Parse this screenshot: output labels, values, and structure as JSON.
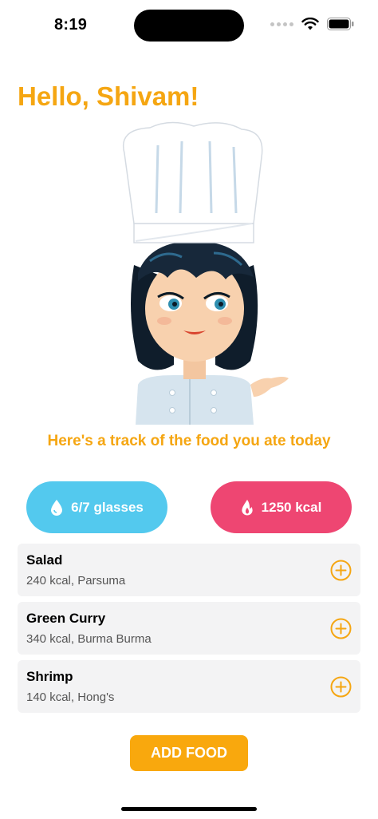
{
  "status_bar": {
    "time": "8:19"
  },
  "greeting": "Hello, Shivam!",
  "subtitle": "Here's a track of the food you ate today",
  "stats": {
    "water": {
      "label": "6/7 glasses",
      "icon": "water-drop-icon",
      "color": "#53c9ee"
    },
    "calories": {
      "label": "1250 kcal",
      "icon": "flame-icon",
      "color": "#ee4672"
    }
  },
  "foods": [
    {
      "name": "Salad",
      "detail": "240 kcal, Parsuma"
    },
    {
      "name": "Green Curry",
      "detail": "340 kcal, Burma Burma"
    },
    {
      "name": "Shrimp",
      "detail": "140 kcal, Hong's"
    }
  ],
  "add_food_label": "ADD FOOD",
  "colors": {
    "accent": "#f5a612",
    "button": "#f9a80d"
  }
}
